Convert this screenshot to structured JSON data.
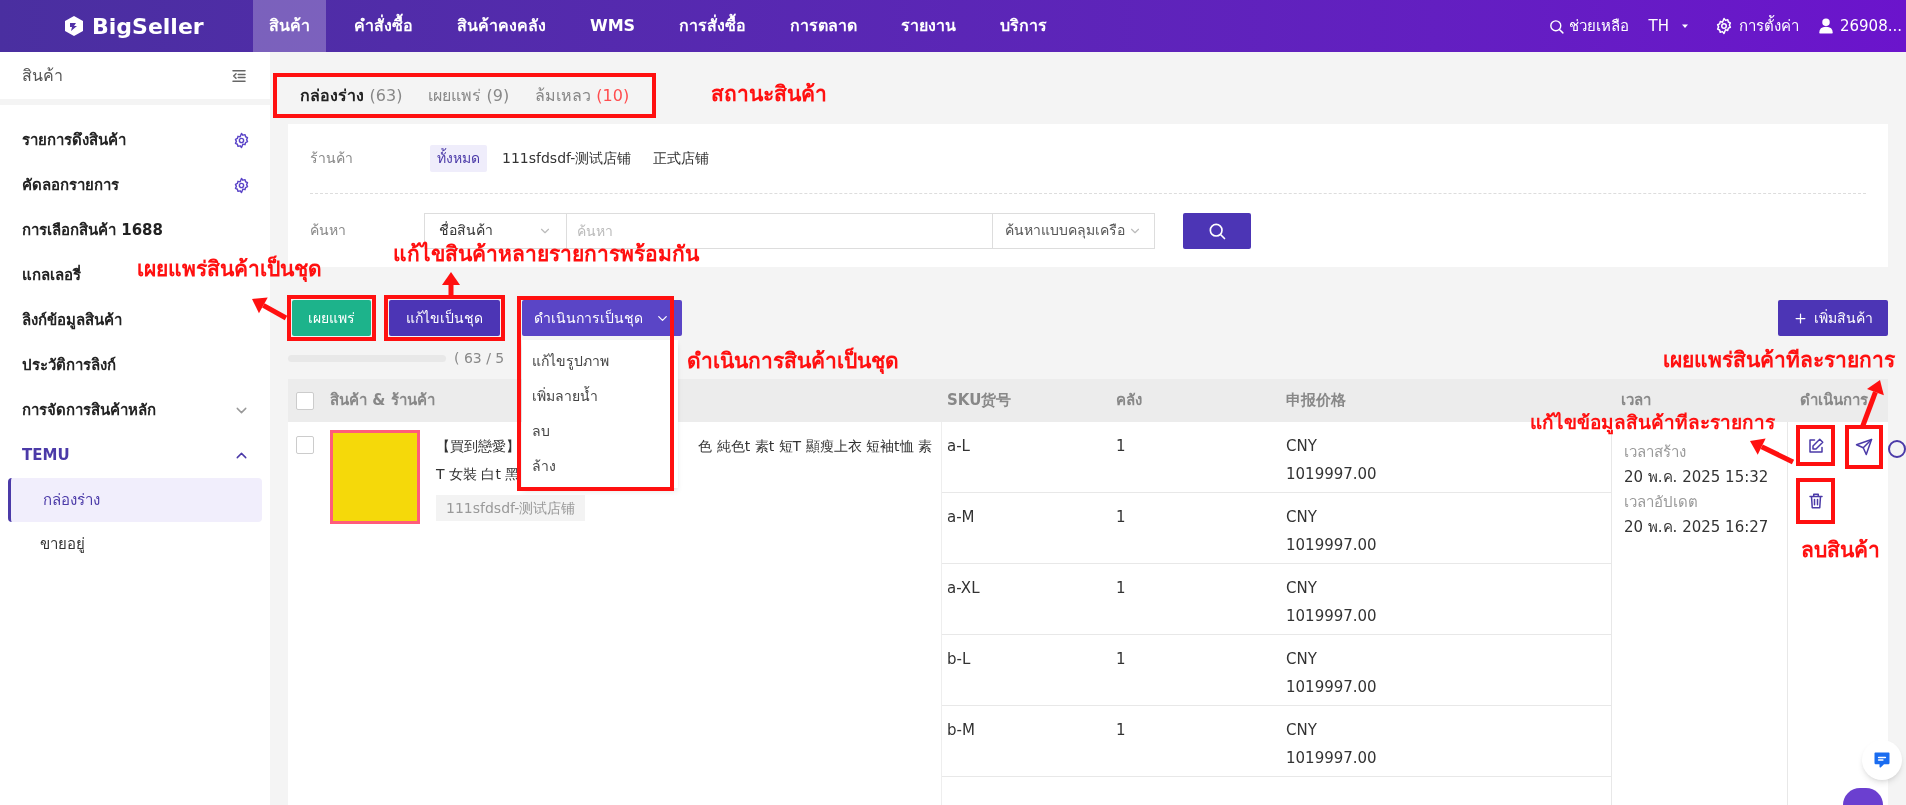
{
  "nav": {
    "logo": "BigSeller",
    "items": [
      {
        "label": "สินค้า",
        "selected": true
      },
      {
        "label": "คำสั่งซื้อ",
        "selected": false
      },
      {
        "label": "สินค้าคงคลัง",
        "selected": false
      },
      {
        "label": "WMS",
        "selected": false
      },
      {
        "label": "การสั่งซื้อ",
        "selected": false
      },
      {
        "label": "การตลาด",
        "selected": false
      },
      {
        "label": "รายงาน",
        "selected": false
      },
      {
        "label": "บริการ",
        "selected": false
      }
    ],
    "help": "ช่วยเหลือ",
    "language": "TH",
    "settings": "การตั้งค่า",
    "user": "26908..."
  },
  "sidebar": {
    "title": "สินค้า",
    "items": [
      {
        "label": "รายการดึงสินค้า",
        "kind": "settings"
      },
      {
        "label": "คัดลอกรายการ",
        "kind": "settings"
      },
      {
        "label": "การเลือกสินค้า 1688",
        "kind": "plain"
      },
      {
        "label": "แกลเลอรี่",
        "kind": "plain"
      },
      {
        "label": "ลิงก์ข้อมูลสินค้า",
        "kind": "plain"
      },
      {
        "label": "ประวัติการลิงก์",
        "kind": "plain"
      },
      {
        "label": "การจัดการสินค้าหลัก",
        "kind": "group",
        "expanded": false
      },
      {
        "label": "TEMU",
        "kind": "group",
        "expanded": true,
        "children": [
          {
            "label": "กล่องร่าง",
            "selected": true
          },
          {
            "label": "ขายอยู่",
            "selected": false
          }
        ]
      }
    ]
  },
  "status_tabs": [
    {
      "label": "กล่องร่าง",
      "count": "(63)",
      "selected": true,
      "warning": false
    },
    {
      "label": "เผยแพร่",
      "count": "(9)",
      "selected": false,
      "warning": false
    },
    {
      "label": "ล้มเหลว",
      "count": "(10)",
      "selected": false,
      "warning": true
    }
  ],
  "filters": {
    "shop_label": "ร้านค้า",
    "shops": [
      {
        "label": "ทั้งหมด",
        "selected": true
      },
      {
        "label": "111sfdsdf-测试店铺",
        "selected": false
      },
      {
        "label": "正式店铺",
        "selected": false
      }
    ],
    "search_label": "ค้นหา",
    "search_field": "ชื่อสินค้า",
    "search_placeholder": "ค้นหา",
    "match_mode": "ค้นหาแบบคลุมเครือ"
  },
  "toolbar": {
    "publish": "เผยแพร่",
    "batch_edit": "แก้ไขเป็นชุด",
    "batch_actions": "ดำเนินการเป็นชุด",
    "batch_menu": [
      "แก้ไขรูปภาพ",
      "เพิ่มลายน้ำ",
      "ลบ",
      "ล้าง"
    ],
    "add_product": "เพิ่มสินค้า"
  },
  "selection_count": "( 63 / 5",
  "table": {
    "all_checked": false,
    "columns": [
      "สินค้า & ร้านค้า",
      "SKU货号",
      "คลัง",
      "申报价格",
      "เวลา",
      "ดำเนินการ"
    ],
    "product": {
      "checked": false,
      "title_parts": [
        "【買到戀愛】",
        "色 純色t 素t 短T 顯瘦上衣 短袖t恤 素",
        "T 女裝 白t 黑"
      ],
      "shop": "111sfdsdf-测试店铺"
    },
    "skus": [
      {
        "sku": "a-L",
        "stock": "1",
        "currency": "CNY",
        "price": "1019997.00"
      },
      {
        "sku": "a-M",
        "stock": "1",
        "currency": "CNY",
        "price": "1019997.00"
      },
      {
        "sku": "a-XL",
        "stock": "1",
        "currency": "CNY",
        "price": "1019997.00"
      },
      {
        "sku": "b-L",
        "stock": "1",
        "currency": "CNY",
        "price": "1019997.00"
      },
      {
        "sku": "b-M",
        "stock": "1",
        "currency": "CNY",
        "price": "1019997.00"
      }
    ],
    "times": [
      {
        "label": "เวลาสร้าง",
        "value": "20 พ.ค. 2025 15:32"
      },
      {
        "label": "เวลาอัปเดต",
        "value": "20 พ.ค. 2025 16:27"
      }
    ]
  },
  "annotations": [
    "สถานะสินค้า",
    "เผยแพร่สินค้าเป็นชุด",
    "แก้ไขสินค้าหลายรายการพร้อมกัน",
    "ดำเนินการสินค้าเป็นชุด",
    "เผยแพร่สินค้าทีละรายการ",
    "แก้ไขข้อมูลสินค้าทีละรายการ",
    "ลบสินค้า"
  ]
}
